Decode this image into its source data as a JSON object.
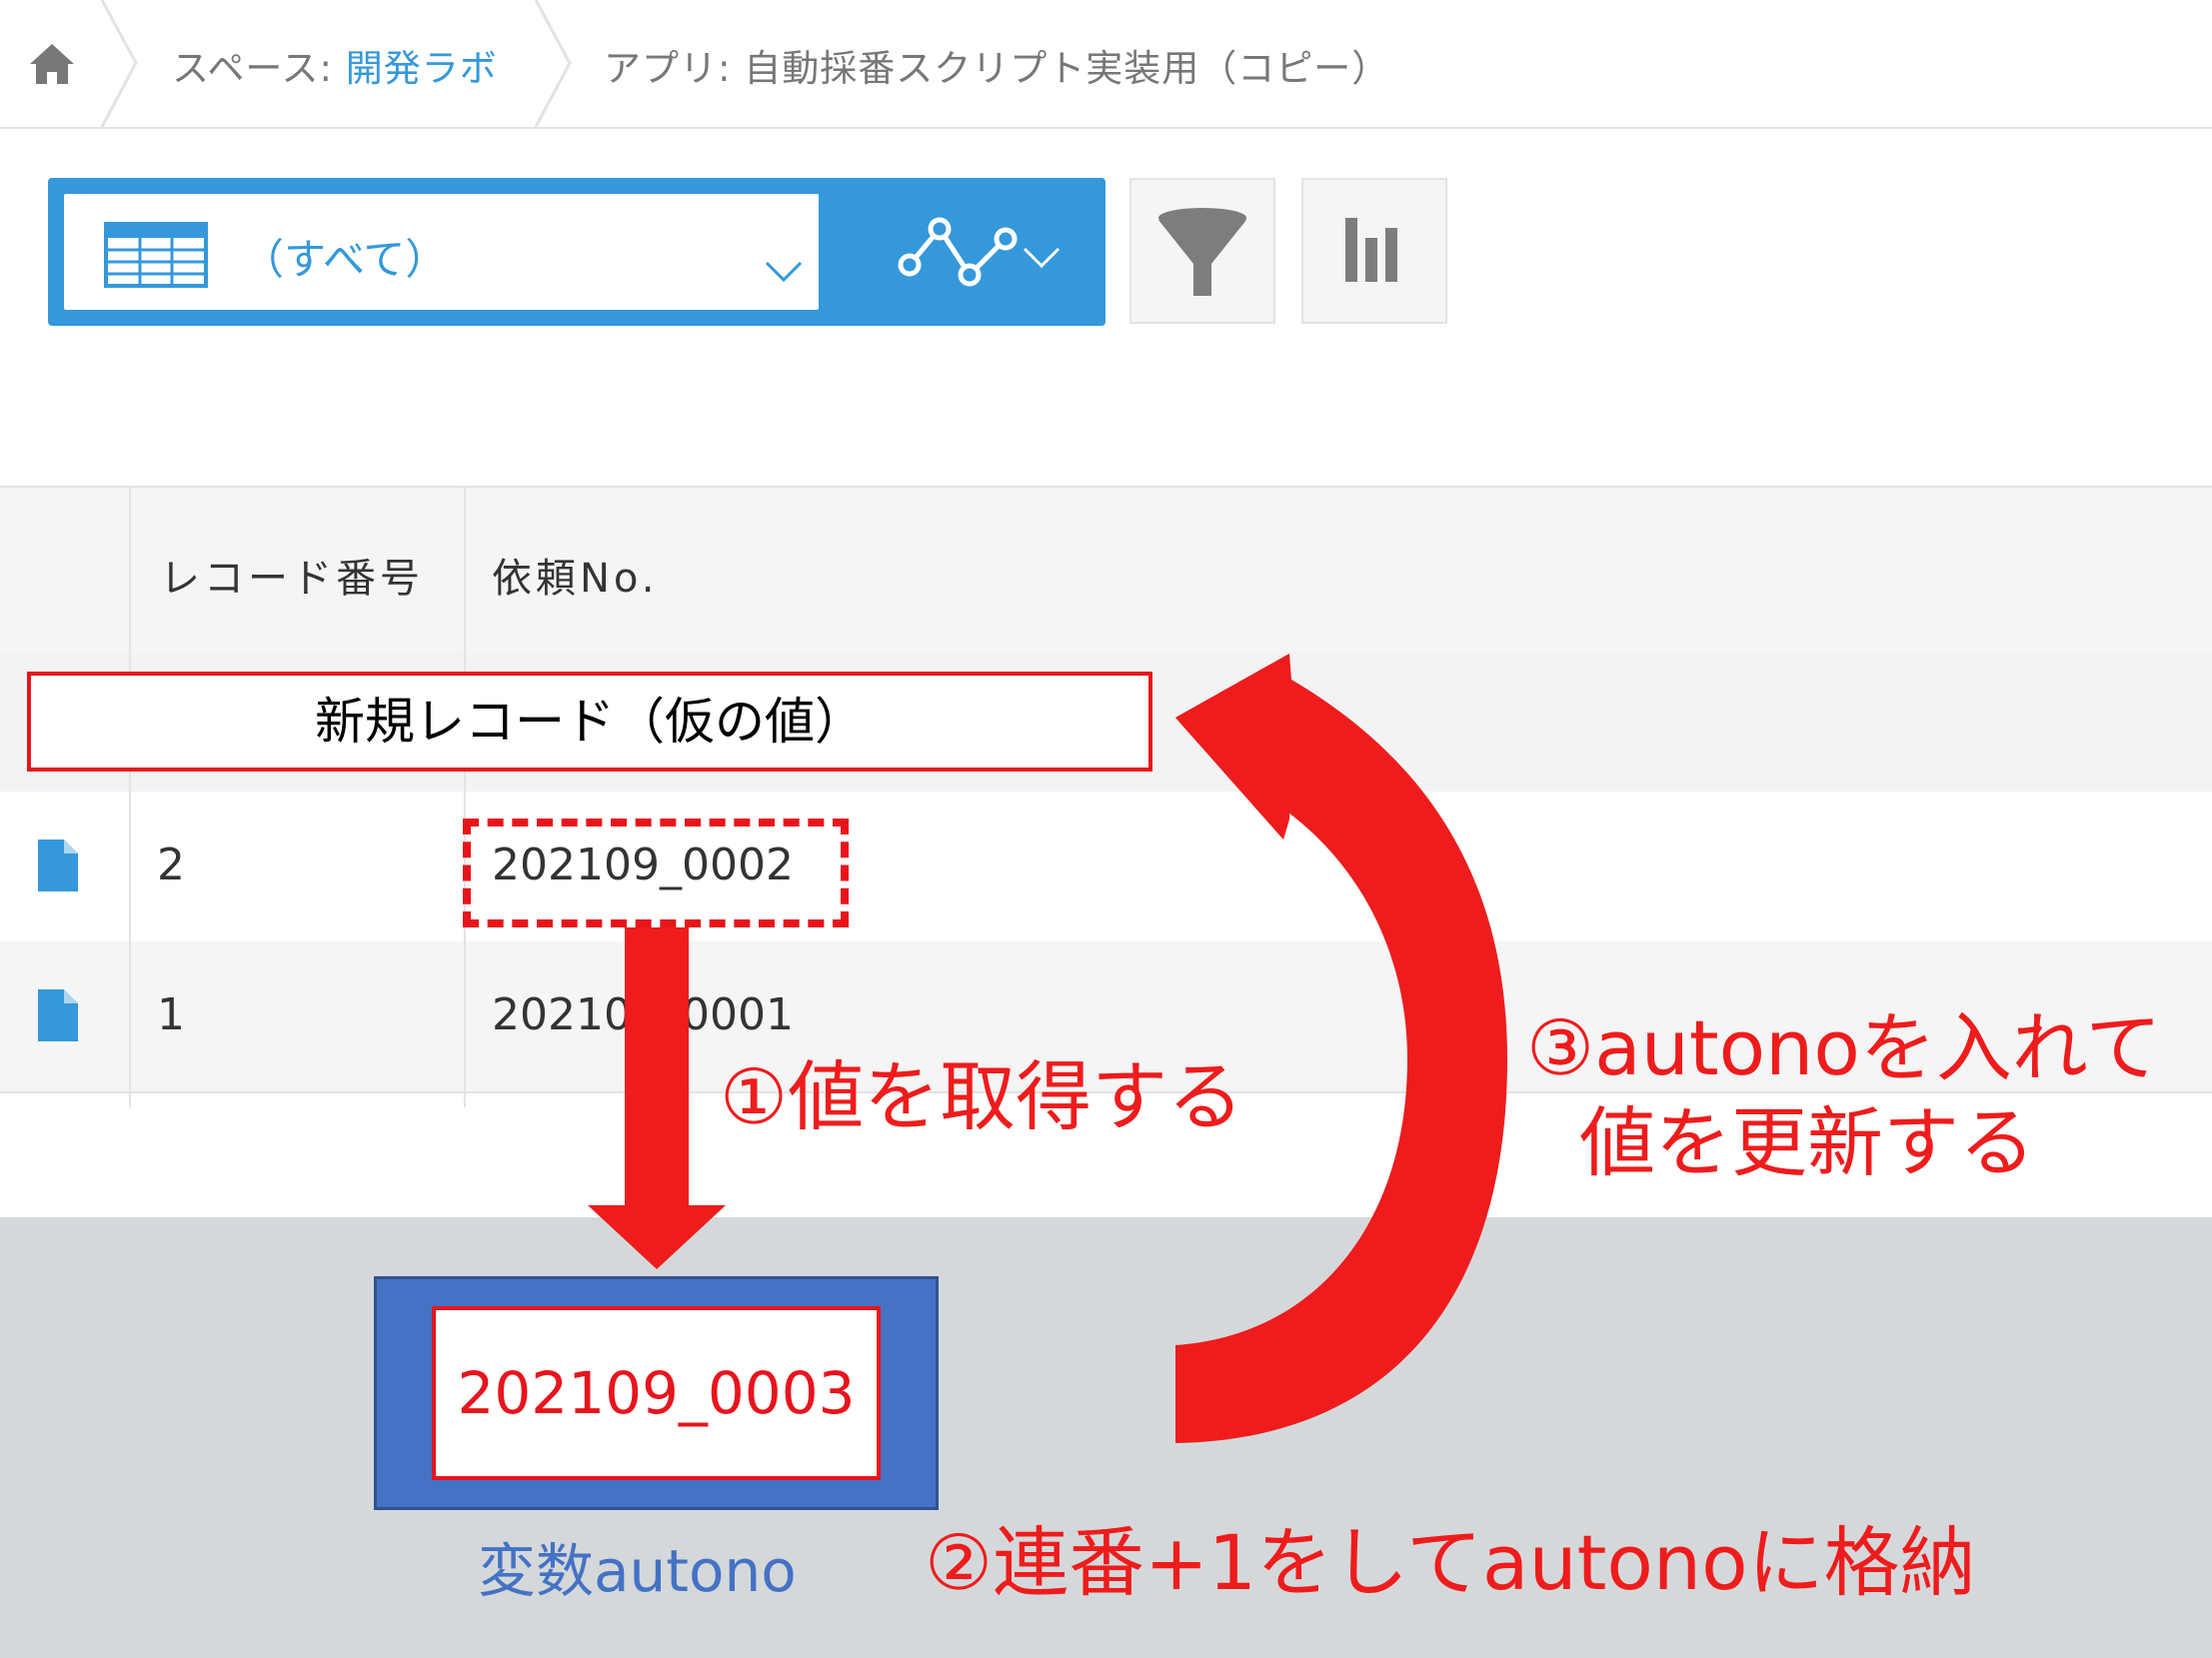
{
  "breadcrumb": {
    "space_prefix": "スペース: ",
    "space_name": "開発ラボ",
    "app_label": "アプリ: 自動採番スクリプト実装用（コピー）"
  },
  "toolbar": {
    "view_label": "（すべて）"
  },
  "table": {
    "headers": [
      "レコード番号",
      "依頼No."
    ],
    "new_record_label": "新規レコード（仮の値）",
    "rows": [
      {
        "record_no": "2",
        "request_no": "202109_0002"
      },
      {
        "record_no": "1",
        "request_no": "202109_0001"
      }
    ]
  },
  "diagram": {
    "variable_value": "202109_0003",
    "variable_caption": "変数autono",
    "step1": "①値を取得する",
    "step2": "②連番+1をしてautonoに格納",
    "step3_line1": "③autonoを入れて",
    "step3_line2": "値を更新する"
  },
  "colors": {
    "accent_blue": "#3498db",
    "annotation_red": "#ee1c1c",
    "variable_box_blue": "#4472c4"
  }
}
